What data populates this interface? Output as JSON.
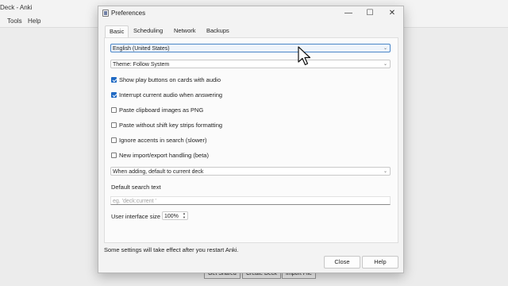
{
  "background_window": {
    "title": "Deck - Anki",
    "menu": [
      "Tools",
      "Help"
    ],
    "bottom_buttons": [
      "Get Shared",
      "Create Deck",
      "Import File"
    ]
  },
  "dialog": {
    "title": "Preferences",
    "controls": {
      "minimize": "—",
      "maximize": "☐",
      "close": "✕"
    },
    "tabs": [
      {
        "label": "Basic",
        "active": true
      },
      {
        "label": "Scheduling",
        "active": false
      },
      {
        "label": "Network",
        "active": false
      },
      {
        "label": "Backups",
        "active": false
      }
    ],
    "language_select": {
      "value": "English (United States)"
    },
    "theme_select": {
      "value": "Theme: Follow System"
    },
    "checkboxes": [
      {
        "label": "Show play buttons on cards with audio",
        "checked": true
      },
      {
        "label": "Interrupt current audio when answering",
        "checked": true
      },
      {
        "label": "Paste clipboard images as PNG",
        "checked": false
      },
      {
        "label": "Paste without shift key strips formatting",
        "checked": false
      },
      {
        "label": "Ignore accents in search (slower)",
        "checked": false
      },
      {
        "label": "New import/export handling (beta)",
        "checked": false
      }
    ],
    "deck_select": {
      "value": "When adding, default to current deck"
    },
    "default_search": {
      "label": "Default search text",
      "placeholder": "eg. 'deck:current '"
    },
    "ui_size": {
      "label": "User interface size",
      "value": "100%"
    },
    "footer_note": "Some settings will take effect after you restart Anki.",
    "buttons": {
      "close": "Close",
      "help": "Help"
    }
  },
  "colors": {
    "accent": "#1f69c3",
    "focus_border": "#4a86c8"
  },
  "icons": [
    "app-icon",
    "chevron-down-icon",
    "spin-arrows-icon",
    "mouse-pointer-icon"
  ]
}
